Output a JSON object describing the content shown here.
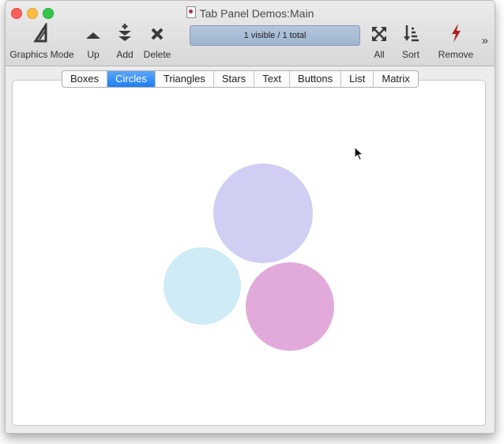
{
  "window": {
    "title": "Tab Panel Demos:Main"
  },
  "toolbar": {
    "items": [
      {
        "label": "Graphics Mode",
        "icon": "triangle-ruler-icon"
      },
      {
        "label": "Up",
        "icon": "up-triangle-icon"
      },
      {
        "label": "Add",
        "icon": "add-down-arrows-icon"
      },
      {
        "label": "Delete",
        "icon": "x-icon"
      },
      {
        "label": "All",
        "icon": "expand-arrows-icon"
      },
      {
        "label": "Sort",
        "icon": "sort-icon"
      },
      {
        "label": "Remove",
        "icon": "lightning-icon"
      }
    ],
    "status": "1 visible / 1 total",
    "overflow": "»"
  },
  "tabs": [
    {
      "label": "Boxes"
    },
    {
      "label": "Circles",
      "active": true
    },
    {
      "label": "Triangles"
    },
    {
      "label": "Stars"
    },
    {
      "label": "Text"
    },
    {
      "label": "Buttons"
    },
    {
      "label": "List"
    },
    {
      "label": "Matrix"
    }
  ],
  "circles": [
    {
      "name": "lavender-circle",
      "color": "#d0cef2"
    },
    {
      "name": "light-blue-circle",
      "color": "#ceebf6"
    },
    {
      "name": "pink-circle",
      "color": "#e2aadb"
    }
  ]
}
